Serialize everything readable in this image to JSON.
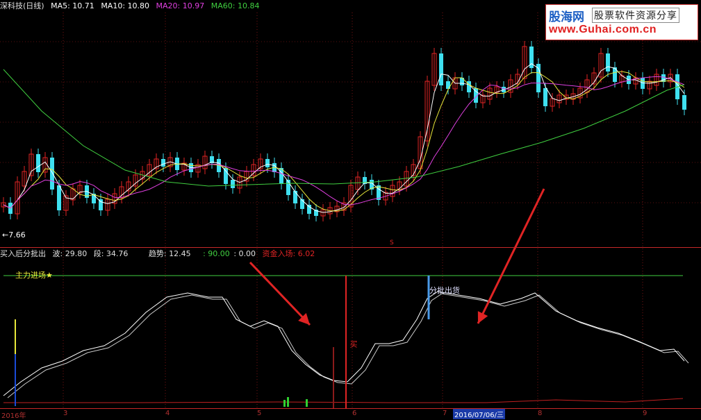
{
  "top_header": {
    "name": "深科技(日线)",
    "ma5": "MA5: 10.71",
    "ma10": "MA10: 10.80",
    "ma20": "MA20: 10.97",
    "ma60": "MA60: 10.84"
  },
  "bottom_header": {
    "name": "买入后分批出",
    "bo": "波: 29.80",
    "duan": "段: 34.76",
    "trend": "趋势: 12.45",
    "v90": ": 90.00",
    "v0": ": 0.00",
    "capital": "资金入场: 6.02"
  },
  "logo": {
    "brand": "股海网",
    "slogan": "股票软件资源分享",
    "url": "www.Guhai.com.cn"
  },
  "annotations": {
    "low_price": "←7.66",
    "main_force": "主力进场★",
    "batch_sell": "分批出货",
    "buy": "买",
    "marker_s": "S"
  },
  "dates": {
    "year": "2016年",
    "m3": "3",
    "m4": "4",
    "m5": "5",
    "m6": "6",
    "m7": "7",
    "selected": "2016/07/06/三",
    "m8": "8",
    "m9": "9"
  },
  "colors": {
    "up": "#e02424",
    "down": "#3fe0f0",
    "ma5": "#ffffff",
    "ma10": "#e8e83a",
    "ma20": "#e040e0",
    "ma60": "#40d040",
    "arrow": "#e02424"
  },
  "chart_data": {
    "type": "candlestick",
    "x_range": [
      "2016-02",
      "2016-09"
    ],
    "low_label": 7.66,
    "indicators": [
      "MA5",
      "MA10",
      "MA20",
      "MA60"
    ]
  }
}
